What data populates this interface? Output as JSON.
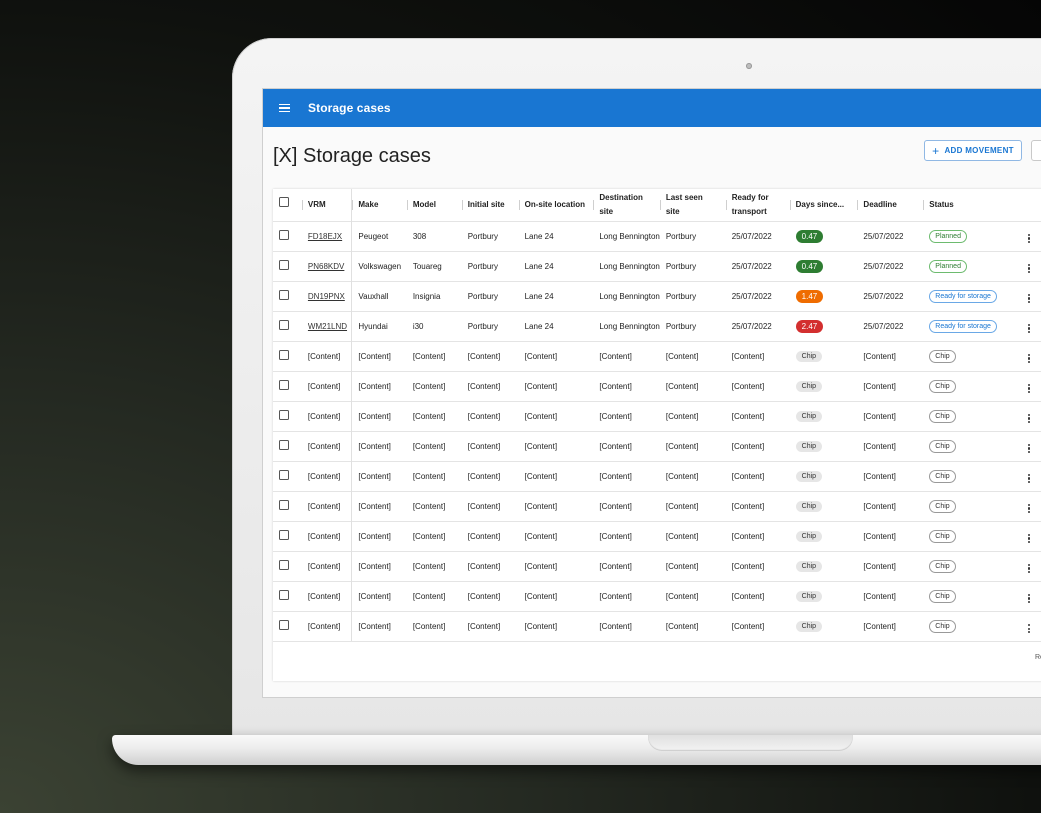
{
  "app": {
    "title": "Storage cases"
  },
  "page": {
    "title": "[X] Storage cases",
    "add_button_label": "ADD MOVEMENT"
  },
  "table": {
    "columns": [
      "VRM",
      "Make",
      "Model",
      "Initial site",
      "On-site location",
      "Destination site",
      "Last seen site",
      "Ready for transport",
      "Days since...",
      "Deadline",
      "Status"
    ],
    "rows": [
      {
        "vrm": "FD18EJX",
        "make": "Peugeot",
        "model": "308",
        "initial": "Portbury",
        "onsite": "Lane 24",
        "dest": "Long Bennington",
        "lastseen": "Portbury",
        "ready": "25/07/2022",
        "days": "0.47",
        "days_color": "#2e7d32",
        "deadline": "25/07/2022",
        "status": "Planned",
        "status_kind": "planned"
      },
      {
        "vrm": "PN68KDV",
        "make": "Volkswagen",
        "model": "Touareg",
        "initial": "Portbury",
        "onsite": "Lane 24",
        "dest": "Long Bennington",
        "lastseen": "Portbury",
        "ready": "25/07/2022",
        "days": "0.47",
        "days_color": "#2e7d32",
        "deadline": "25/07/2022",
        "status": "Planned",
        "status_kind": "planned"
      },
      {
        "vrm": "DN19PNX",
        "make": "Vauxhall",
        "model": "Insignia",
        "initial": "Portbury",
        "onsite": "Lane 24",
        "dest": "Long Bennington",
        "lastseen": "Portbury",
        "ready": "25/07/2022",
        "days": "1.47",
        "days_color": "#ef6c00",
        "deadline": "25/07/2022",
        "status": "Ready for storage",
        "status_kind": "ready"
      },
      {
        "vrm": "WM21LND",
        "make": "Hyundai",
        "model": "i30",
        "initial": "Portbury",
        "onsite": "Lane 24",
        "dest": "Long Bennington",
        "lastseen": "Portbury",
        "ready": "25/07/2022",
        "days": "2.47",
        "days_color": "#d32f2f",
        "deadline": "25/07/2022",
        "status": "Ready for storage",
        "status_kind": "ready"
      },
      {
        "vrm": "[Content]",
        "make": "[Content]",
        "model": "[Content]",
        "initial": "[Content]",
        "onsite": "[Content]",
        "dest": "[Content]",
        "lastseen": "[Content]",
        "ready": "[Content]",
        "days": "Chip",
        "days_color": "",
        "deadline": "[Content]",
        "status": "Chip",
        "status_kind": "chip"
      },
      {
        "vrm": "[Content]",
        "make": "[Content]",
        "model": "[Content]",
        "initial": "[Content]",
        "onsite": "[Content]",
        "dest": "[Content]",
        "lastseen": "[Content]",
        "ready": "[Content]",
        "days": "Chip",
        "days_color": "",
        "deadline": "[Content]",
        "status": "Chip",
        "status_kind": "chip"
      },
      {
        "vrm": "[Content]",
        "make": "[Content]",
        "model": "[Content]",
        "initial": "[Content]",
        "onsite": "[Content]",
        "dest": "[Content]",
        "lastseen": "[Content]",
        "ready": "[Content]",
        "days": "Chip",
        "days_color": "",
        "deadline": "[Content]",
        "status": "Chip",
        "status_kind": "chip"
      },
      {
        "vrm": "[Content]",
        "make": "[Content]",
        "model": "[Content]",
        "initial": "[Content]",
        "onsite": "[Content]",
        "dest": "[Content]",
        "lastseen": "[Content]",
        "ready": "[Content]",
        "days": "Chip",
        "days_color": "",
        "deadline": "[Content]",
        "status": "Chip",
        "status_kind": "chip"
      },
      {
        "vrm": "[Content]",
        "make": "[Content]",
        "model": "[Content]",
        "initial": "[Content]",
        "onsite": "[Content]",
        "dest": "[Content]",
        "lastseen": "[Content]",
        "ready": "[Content]",
        "days": "Chip",
        "days_color": "",
        "deadline": "[Content]",
        "status": "Chip",
        "status_kind": "chip"
      },
      {
        "vrm": "[Content]",
        "make": "[Content]",
        "model": "[Content]",
        "initial": "[Content]",
        "onsite": "[Content]",
        "dest": "[Content]",
        "lastseen": "[Content]",
        "ready": "[Content]",
        "days": "Chip",
        "days_color": "",
        "deadline": "[Content]",
        "status": "Chip",
        "status_kind": "chip"
      },
      {
        "vrm": "[Content]",
        "make": "[Content]",
        "model": "[Content]",
        "initial": "[Content]",
        "onsite": "[Content]",
        "dest": "[Content]",
        "lastseen": "[Content]",
        "ready": "[Content]",
        "days": "Chip",
        "days_color": "",
        "deadline": "[Content]",
        "status": "Chip",
        "status_kind": "chip"
      },
      {
        "vrm": "[Content]",
        "make": "[Content]",
        "model": "[Content]",
        "initial": "[Content]",
        "onsite": "[Content]",
        "dest": "[Content]",
        "lastseen": "[Content]",
        "ready": "[Content]",
        "days": "Chip",
        "days_color": "",
        "deadline": "[Content]",
        "status": "Chip",
        "status_kind": "chip"
      },
      {
        "vrm": "[Content]",
        "make": "[Content]",
        "model": "[Content]",
        "initial": "[Content]",
        "onsite": "[Content]",
        "dest": "[Content]",
        "lastseen": "[Content]",
        "ready": "[Content]",
        "days": "Chip",
        "days_color": "",
        "deadline": "[Content]",
        "status": "Chip",
        "status_kind": "chip"
      },
      {
        "vrm": "[Content]",
        "make": "[Content]",
        "model": "[Content]",
        "initial": "[Content]",
        "onsite": "[Content]",
        "dest": "[Content]",
        "lastseen": "[Content]",
        "ready": "[Content]",
        "days": "Chip",
        "days_color": "",
        "deadline": "[Content]",
        "status": "Chip",
        "status_kind": "chip"
      }
    ],
    "footer_text": "Ro"
  },
  "colors": {
    "app_bar": "#1976d2",
    "accent": "#1976d2"
  }
}
